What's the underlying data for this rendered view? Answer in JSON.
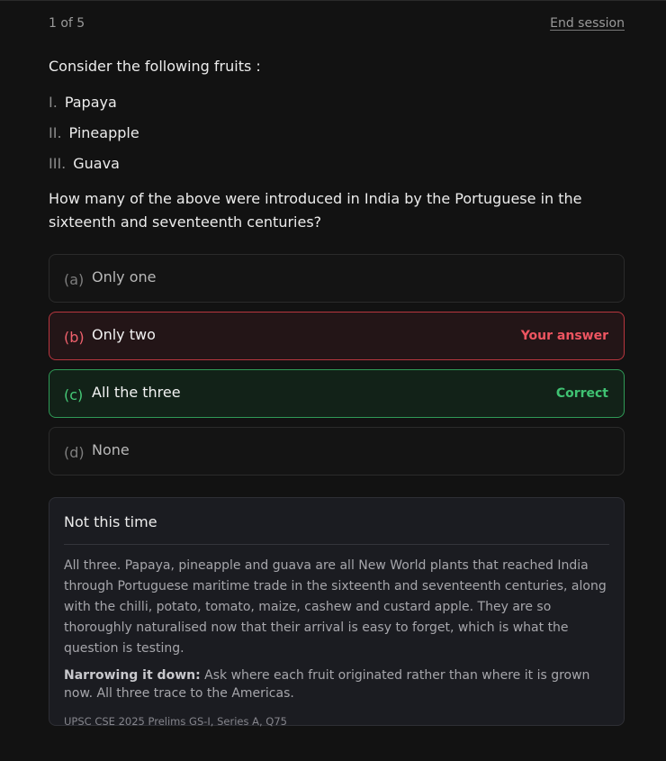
{
  "header": {
    "counter": "1 of 5",
    "end_session": "End session"
  },
  "question": {
    "intro": "Consider the following fruits :",
    "items": [
      {
        "num": "I.",
        "label": "Papaya"
      },
      {
        "num": "II.",
        "label": "Pineapple"
      },
      {
        "num": "III.",
        "label": "Guava"
      }
    ],
    "prompt": "How many of the above were introduced in India by the Portuguese in the sixteenth and seventeenth centuries?"
  },
  "options": [
    {
      "letter": "(a)",
      "text": "Only one",
      "tag": "",
      "state": "neutral"
    },
    {
      "letter": "(b)",
      "text": "Only two",
      "tag": "Your answer",
      "state": "wrong"
    },
    {
      "letter": "(c)",
      "text": "All the three",
      "tag": "Correct",
      "state": "right"
    },
    {
      "letter": "(d)",
      "text": "None",
      "tag": "",
      "state": "neutral"
    }
  ],
  "colors": {
    "wrong_accent": "#ee5561",
    "correct_accent": "#3fc272"
  },
  "feedback": {
    "title": "Not this time",
    "explanation": "All three. Papaya, pineapple and guava are all New World plants that reached India through Portuguese maritime trade in the sixteenth and seventeenth centuries, along with the chilli, potato, tomato, maize, cashew and custard apple. They are so thoroughly naturalised now that their arrival is easy to forget, which is what the question is testing.",
    "narrow_lead": "Narrowing it down:",
    "narrow_text": " Ask where each fruit originated rather than where it is grown now. All three trace to the Americas.",
    "source": "UPSC CSE 2025 Prelims GS-I, Series A, Q75"
  }
}
